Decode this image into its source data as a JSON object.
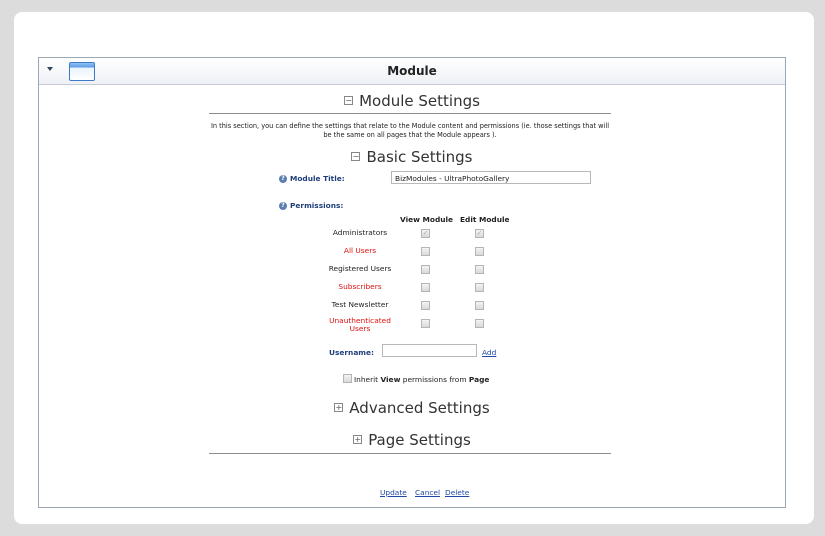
{
  "window": {
    "title": "Module"
  },
  "sections": {
    "module_settings": "Module Settings",
    "basic_settings": "Basic Settings",
    "advanced_settings": "Advanced Settings",
    "page_settings": "Page Settings"
  },
  "intro": "In this section, you can define the settings that relate to the Module content and permissions (ie. those settings that will be the same on all pages that the Module appears ).",
  "module_title": {
    "label": "Module Title:",
    "value": "BizModules - UltraPhotoGallery"
  },
  "permissions": {
    "label": "Permissions:",
    "columns": [
      "View Module",
      "Edit Module"
    ],
    "rows": [
      {
        "role": "Administrators",
        "highlight": false,
        "view": true,
        "edit": true
      },
      {
        "role": "All Users",
        "highlight": true,
        "view": false,
        "edit": false
      },
      {
        "role": "Registered Users",
        "highlight": false,
        "view": false,
        "edit": false
      },
      {
        "role": "Subscribers",
        "highlight": true,
        "view": false,
        "edit": false
      },
      {
        "role": "Test Newsletter",
        "highlight": false,
        "view": false,
        "edit": false
      },
      {
        "role": "Unauthenticated Users",
        "highlight": true,
        "view": false,
        "edit": false
      }
    ]
  },
  "username": {
    "label": "Username:",
    "value": "",
    "add_label": "Add"
  },
  "inherit": {
    "pre": "Inherit ",
    "view": "View",
    "mid": " permissions from ",
    "page": "Page",
    "checked": false
  },
  "actions": {
    "update": "Update",
    "cancel": "Cancel",
    "delete": "Delete"
  },
  "colors": {
    "role_highlight": "#e01010",
    "label_blue": "#1f3f7a",
    "link_blue": "#2047a8"
  }
}
